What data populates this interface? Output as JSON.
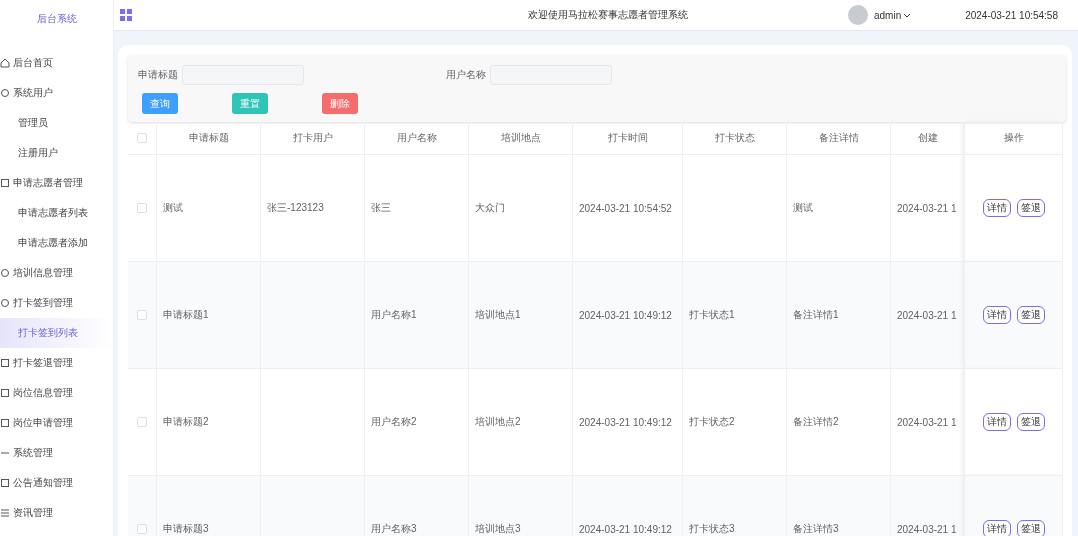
{
  "sidebar": {
    "title": "后台系统",
    "items": [
      {
        "label": "后台首页"
      },
      {
        "label": "系统用户",
        "children": [
          {
            "label": "管理员",
            "selected": false
          },
          {
            "label": "注册用户",
            "selected": false
          }
        ]
      },
      {
        "label": "申请志愿者管理",
        "children": [
          {
            "label": "申请志愿者列表",
            "selected": false
          },
          {
            "label": "申请志愿者添加",
            "selected": false
          }
        ]
      },
      {
        "label": "培训信息管理"
      },
      {
        "label": "打卡签到管理",
        "children": [
          {
            "label": "打卡签到列表",
            "selected": true
          }
        ]
      },
      {
        "label": "打卡签退管理"
      },
      {
        "label": "岗位信息管理"
      },
      {
        "label": "岗位申请管理"
      },
      {
        "label": "系统管理"
      },
      {
        "label": "公告通知管理"
      },
      {
        "label": "资讯管理"
      }
    ]
  },
  "header": {
    "title": "欢迎使用马拉松赛事志愿者管理系统",
    "user": "admin",
    "time": "2024-03-21 10:54:58"
  },
  "filters": [
    {
      "label": "申请标题"
    },
    {
      "label": "用户名称"
    }
  ],
  "buttons": [
    {
      "label": "查询",
      "kind": "primary"
    },
    {
      "label": "重置",
      "kind": "success"
    },
    {
      "label": "删除",
      "kind": "danger"
    }
  ],
  "table": {
    "all_checked": false,
    "columns": [
      "申请标题",
      "打卡用户",
      "用户名称",
      "培训地点",
      "打卡时间",
      "打卡状态",
      "备注详情",
      "创建"
    ],
    "action_column": "操作",
    "rows": [
      {
        "checked": false,
        "cells": [
          "测试",
          "张三-123123",
          "张三",
          "大众门",
          "2024-03-21 10:54:52",
          "",
          "测试",
          "2024-03-21 1"
        ],
        "actions": [
          "详情",
          "签退"
        ]
      },
      {
        "checked": false,
        "cells": [
          "申请标题1",
          "",
          "用户名称1",
          "培训地点1",
          "2024-03-21 10:49:12",
          "打卡状态1",
          "备注详情1",
          "2024-03-21 1"
        ],
        "actions": [
          "详情",
          "签退"
        ]
      },
      {
        "checked": false,
        "cells": [
          "申请标题2",
          "",
          "用户名称2",
          "培训地点2",
          "2024-03-21 10:49:12",
          "打卡状态2",
          "备注详情2",
          "2024-03-21 1"
        ],
        "actions": [
          "详情",
          "签退"
        ]
      },
      {
        "checked": false,
        "cells": [
          "申请标题3",
          "",
          "用户名称3",
          "培训地点3",
          "2024-03-21 10:49:12",
          "打卡状态3",
          "备注详情3",
          "2024-03-21 1"
        ],
        "actions": [
          "详情",
          "签退"
        ]
      }
    ]
  }
}
